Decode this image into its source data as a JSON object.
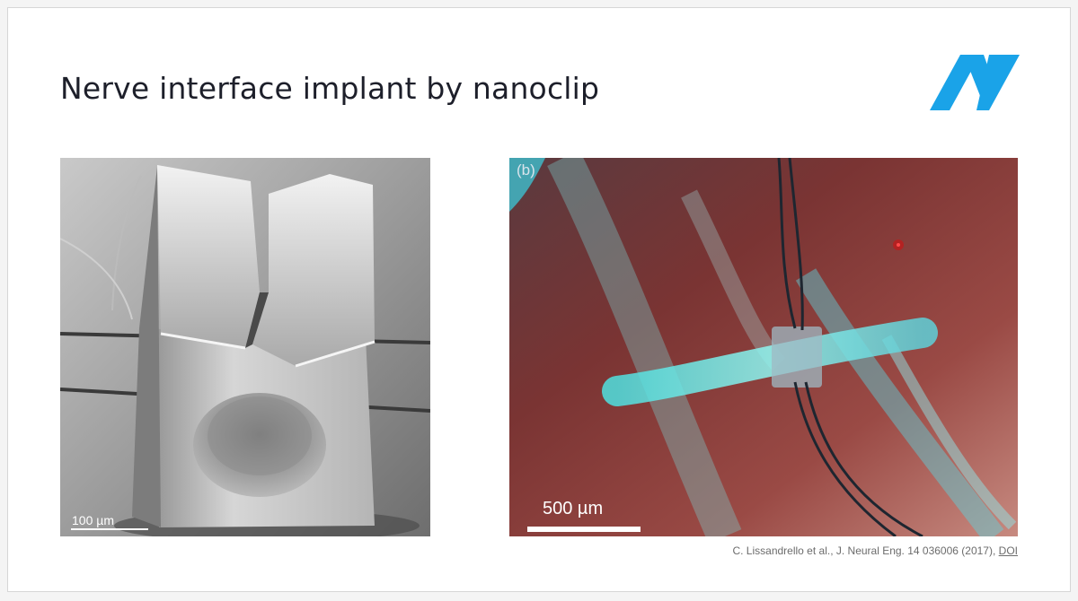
{
  "slide": {
    "title": "Nerve interface implant by nanoclip",
    "logo_color": "#1aa3e8"
  },
  "left_image": {
    "scale_label": "100 µm"
  },
  "right_image": {
    "panel_label": "(b)",
    "scale_label": "500 µm"
  },
  "citation": {
    "text": "C. Lissandrello et al., J. Neural Eng. 14 036006 (2017), ",
    "doi_label": "DOI"
  }
}
